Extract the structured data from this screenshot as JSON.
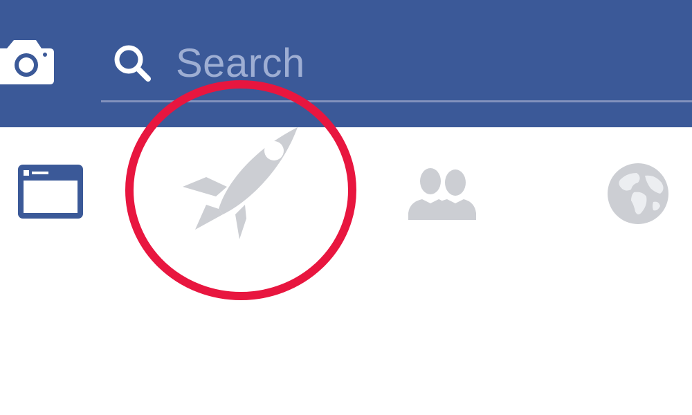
{
  "header": {
    "camera_icon": "camera-icon",
    "search": {
      "icon": "search-icon",
      "placeholder": "Search"
    }
  },
  "tabs": [
    {
      "id": "news-feed",
      "icon": "news-feed-icon",
      "active": true
    },
    {
      "id": "explore-feed",
      "icon": "rocket-icon",
      "active": false,
      "highlighted": true
    },
    {
      "id": "friend-requests",
      "icon": "friends-icon",
      "active": false
    },
    {
      "id": "notifications",
      "icon": "globe-icon",
      "active": false
    }
  ],
  "colors": {
    "brand_blue": "#3b5998",
    "placeholder_text": "#9eaed3",
    "inactive_icon": "#ccced3",
    "highlight_ring": "#e8163f"
  }
}
